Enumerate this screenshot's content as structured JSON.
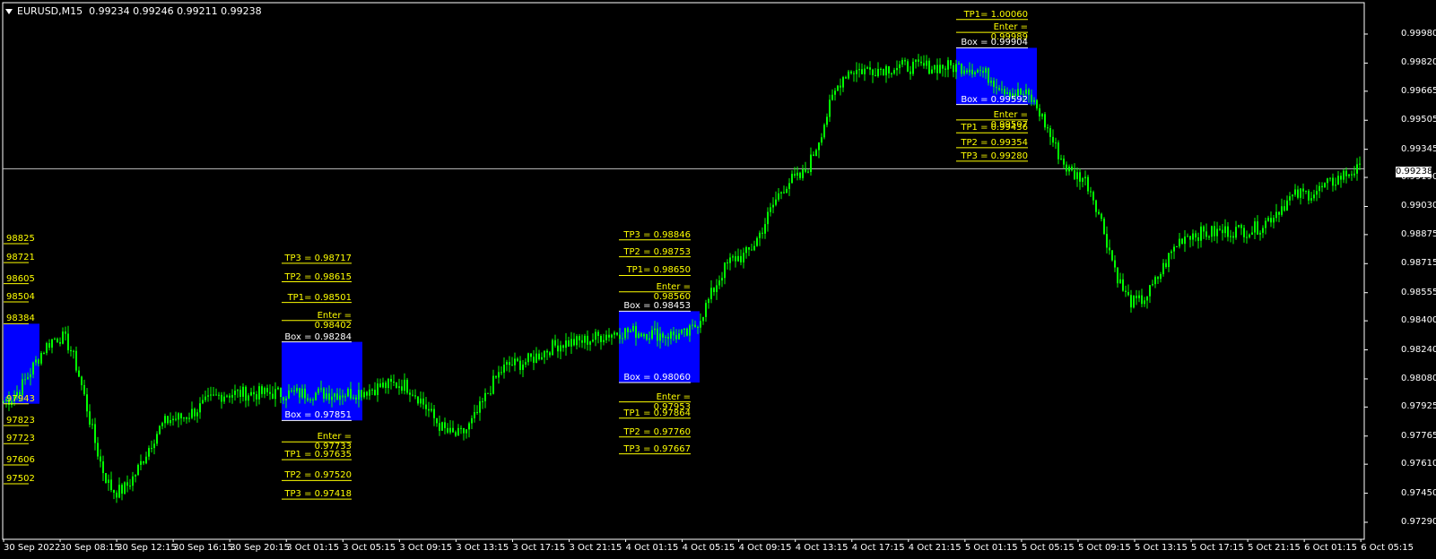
{
  "header": {
    "symbol_tf": "EURUSD,M15",
    "ohlc": "0.99234 0.99246 0.99211 0.99238"
  },
  "colors": {
    "background": "#000000",
    "candle": "#00ff00",
    "box": "#0000ff",
    "level": "#ffff00",
    "axis": "#ffffff",
    "bid_line": "#c0c0c0"
  },
  "y_axis": {
    "labels": [
      "0.99980",
      "0.99820",
      "0.99665",
      "0.99505",
      "0.99345",
      "0.99190",
      "0.99030",
      "0.98875",
      "0.98715",
      "0.98555",
      "0.98400",
      "0.98240",
      "0.98080",
      "0.97925",
      "0.97765",
      "0.97610",
      "0.97450",
      "0.97290"
    ]
  },
  "current_price": "0.99238",
  "x_axis": {
    "labels": [
      "30 Sep 2022",
      "30 Sep 08:15",
      "30 Sep 12:15",
      "30 Sep 16:15",
      "30 Sep 20:15",
      "3 Oct 01:15",
      "3 Oct 05:15",
      "3 Oct 09:15",
      "3 Oct 13:15",
      "3 Oct 17:15",
      "3 Oct 21:15",
      "4 Oct 01:15",
      "4 Oct 05:15",
      "4 Oct 09:15",
      "4 Oct 13:15",
      "4 Oct 17:15",
      "4 Oct 21:15",
      "5 Oct 01:15",
      "5 Oct 05:15",
      "5 Oct 09:15",
      "5 Oct 13:15",
      "5 Oct 17:15",
      "5 Oct 21:15",
      "6 Oct 01:15",
      "6 Oct 05:15"
    ]
  },
  "left_labels": [
    "98825",
    "98721",
    "98605",
    "98504",
    "98384",
    "97943",
    "97823",
    "97723",
    "97606",
    "97502"
  ],
  "setups": [
    {
      "box_top": 0.98284,
      "box_bottom": 0.97851,
      "above": [
        {
          "text": "TP3 = 0.98717",
          "price": 0.98717
        },
        {
          "text": "TP2 = 0.98615",
          "price": 0.98615
        },
        {
          "text": "TP1= 0.98501",
          "price": 0.98501
        },
        {
          "text": "Enter = 0.98402",
          "price": 0.98402
        },
        {
          "text": "Box = 0.98284",
          "price": 0.98284
        }
      ],
      "below": [
        {
          "text": "Box = 0.97851",
          "price": 0.97851
        },
        {
          "text": "Enter = 0.97733",
          "price": 0.97733
        },
        {
          "text": "TP1 = 0.97635",
          "price": 0.97635
        },
        {
          "text": "TP2 = 0.97520",
          "price": 0.9752
        },
        {
          "text": "TP3 = 0.97418",
          "price": 0.97418
        }
      ]
    },
    {
      "box_top": 0.98453,
      "box_bottom": 0.9806,
      "above": [
        {
          "text": "TP3 = 0.98846",
          "price": 0.98846
        },
        {
          "text": "TP2 = 0.98753",
          "price": 0.98753
        },
        {
          "text": "TP1= 0.98650",
          "price": 0.9865
        },
        {
          "text": "Enter = 0.98560",
          "price": 0.9856
        },
        {
          "text": "Box = 0.98453",
          "price": 0.98453
        }
      ],
      "below": [
        {
          "text": "Box = 0.98060",
          "price": 0.9806
        },
        {
          "text": "Enter = 0.97953",
          "price": 0.97953
        },
        {
          "text": "TP1 = 0.97864",
          "price": 0.97864
        },
        {
          "text": "TP2 = 0.97760",
          "price": 0.9776
        },
        {
          "text": "TP3 = 0.97667",
          "price": 0.97667
        }
      ]
    },
    {
      "box_top": 0.99904,
      "box_bottom": 0.99592,
      "above": [
        {
          "text": "TP1= 1.00060",
          "price": 1.0006
        },
        {
          "text": "Enter = 0.99989",
          "price": 0.99989
        },
        {
          "text": "Box = 0.99904",
          "price": 0.99904
        }
      ],
      "below": [
        {
          "text": "Box = 0.99592",
          "price": 0.99592
        },
        {
          "text": "Enter = 0.99507",
          "price": 0.99507
        },
        {
          "text": "TP1 = 0.99436",
          "price": 0.99436
        },
        {
          "text": "TP2 = 0.99354",
          "price": 0.99354
        },
        {
          "text": "TP3 = 0.99280",
          "price": 0.9928
        }
      ]
    }
  ],
  "chart_data": {
    "type": "candlestick",
    "series": [
      {
        "name": "EURUSD,M15",
        "values": [
          {
            "t": "30 Sep 2022",
            "close": 0.9796
          },
          {
            "t": "30 Sep 08:15",
            "close": 0.9831
          },
          {
            "t": "30 Sep 12:15",
            "close": 0.9746
          },
          {
            "t": "30 Sep 16:15",
            "close": 0.9786
          },
          {
            "t": "30 Sep 20:15",
            "close": 0.98
          },
          {
            "t": "3 Oct 01:15",
            "close": 0.98
          },
          {
            "t": "3 Oct 05:15",
            "close": 0.98
          },
          {
            "t": "3 Oct 09:15",
            "close": 0.9805
          },
          {
            "t": "3 Oct 13:15",
            "close": 0.9777
          },
          {
            "t": "3 Oct 17:15",
            "close": 0.9816
          },
          {
            "t": "3 Oct 21:15",
            "close": 0.9828
          },
          {
            "t": "4 Oct 01:15",
            "close": 0.9834
          },
          {
            "t": "4 Oct 05:15",
            "close": 0.9832
          },
          {
            "t": "4 Oct 09:15",
            "close": 0.9875
          },
          {
            "t": "4 Oct 13:15",
            "close": 0.9918
          },
          {
            "t": "4 Oct 17:15",
            "close": 0.9978
          },
          {
            "t": "4 Oct 21:15",
            "close": 0.998
          },
          {
            "t": "5 Oct 01:15",
            "close": 0.998
          },
          {
            "t": "5 Oct 05:15",
            "close": 0.9965
          },
          {
            "t": "5 Oct 09:15",
            "close": 0.992
          },
          {
            "t": "5 Oct 13:15",
            "close": 0.985
          },
          {
            "t": "5 Oct 17:15",
            "close": 0.9888
          },
          {
            "t": "5 Oct 21:15",
            "close": 0.989
          },
          {
            "t": "6 Oct 01:15",
            "close": 0.991
          },
          {
            "t": "6 Oct 05:15",
            "close": 0.9923
          }
        ]
      }
    ],
    "ylim": [
      0.9726,
      1.001
    ],
    "grid": false
  }
}
